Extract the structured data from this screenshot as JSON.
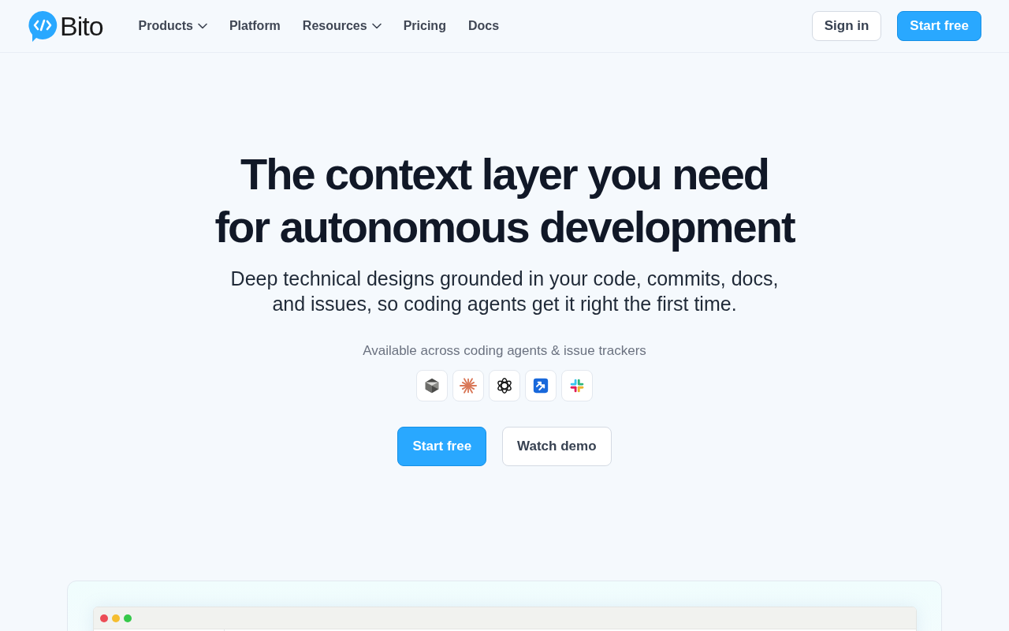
{
  "nav": {
    "logo": "Bito",
    "links": [
      {
        "label": "Products",
        "dropdown": true
      },
      {
        "label": "Platform",
        "dropdown": false
      },
      {
        "label": "Resources",
        "dropdown": true
      },
      {
        "label": "Pricing",
        "dropdown": false
      },
      {
        "label": "Docs",
        "dropdown": false
      }
    ],
    "actions": [
      {
        "label": "Sign in",
        "kind": "secondary"
      },
      {
        "label": "Start free",
        "kind": "primary"
      }
    ]
  },
  "hero": {
    "title_lines": [
      "The context layer you need",
      "for autonomous development"
    ],
    "subtitle_lines": [
      "Deep technical designs grounded in your code, commits, docs,",
      "and issues, so coding agents get it right the first time."
    ],
    "integrations_label": "Available across coding agents & issue trackers",
    "buttons": [
      {
        "label": "Start free",
        "kind": "primary"
      },
      {
        "label": "Watch demo",
        "kind": "secondary"
      }
    ]
  }
}
